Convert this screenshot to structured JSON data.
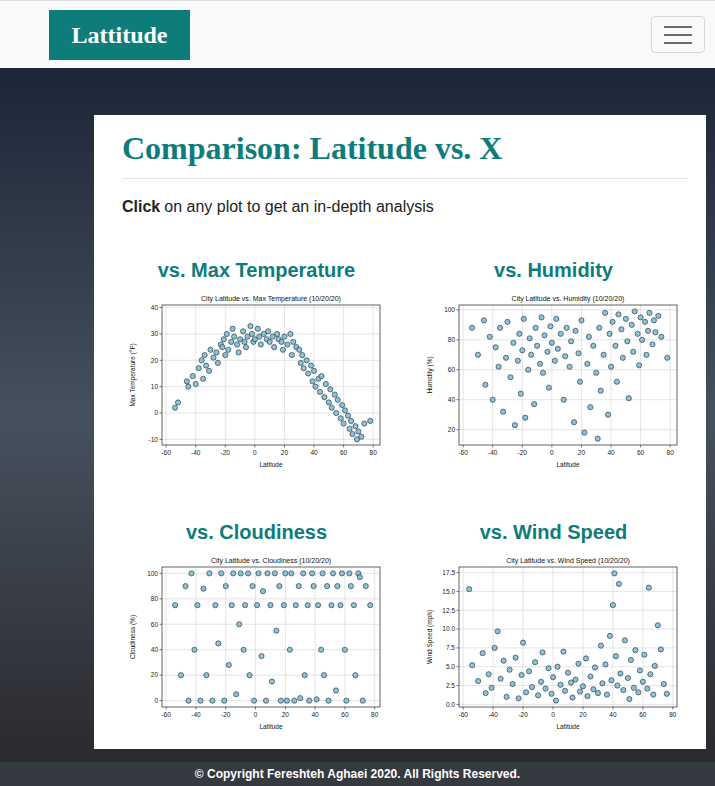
{
  "navbar": {
    "brand": "Lattitude"
  },
  "card": {
    "title": "Comparison: Latitude vs. X",
    "intro": {
      "emphasis": "Click",
      "text": "on any plot to get an in-depth analysis"
    }
  },
  "charts": [
    {
      "heading": "vs. Max Temperature",
      "title": "City Latitude vs. Max Temperature (10/20/20)",
      "x_label": "Latitude",
      "y_label": "Max Temperature (°F)",
      "x_ticks": [
        "-60",
        "-40",
        "-20",
        "0",
        "20",
        "40",
        "60",
        "80"
      ],
      "y_ticks": [
        "-10",
        "0",
        "10",
        "20",
        "30",
        "40"
      ],
      "points": [
        [
          -54,
          2
        ],
        [
          -52,
          4
        ],
        [
          -46,
          12
        ],
        [
          -45,
          10
        ],
        [
          -42,
          14
        ],
        [
          -40,
          11
        ],
        [
          -38,
          17
        ],
        [
          -36,
          20
        ],
        [
          -35,
          13
        ],
        [
          -34,
          22
        ],
        [
          -33,
          18
        ],
        [
          -31,
          16
        ],
        [
          -30,
          24
        ],
        [
          -28,
          21
        ],
        [
          -26,
          23
        ],
        [
          -25,
          19
        ],
        [
          -23,
          26
        ],
        [
          -22,
          25
        ],
        [
          -21,
          28
        ],
        [
          -20,
          22
        ],
        [
          -19,
          30
        ],
        [
          -18,
          24
        ],
        [
          -16,
          27
        ],
        [
          -15,
          32
        ],
        [
          -14,
          29
        ],
        [
          -12,
          26
        ],
        [
          -11,
          23
        ],
        [
          -10,
          28
        ],
        [
          -8,
          31
        ],
        [
          -7,
          27
        ],
        [
          -6,
          25
        ],
        [
          -5,
          29
        ],
        [
          -3,
          33
        ],
        [
          -2,
          30
        ],
        [
          -1,
          27
        ],
        [
          0,
          28
        ],
        [
          2,
          32
        ],
        [
          3,
          29
        ],
        [
          4,
          26
        ],
        [
          6,
          30
        ],
        [
          8,
          28
        ],
        [
          9,
          31
        ],
        [
          10,
          27
        ],
        [
          12,
          29
        ],
        [
          13,
          25
        ],
        [
          15,
          30
        ],
        [
          16,
          28
        ],
        [
          18,
          27
        ],
        [
          19,
          24
        ],
        [
          20,
          29
        ],
        [
          22,
          26
        ],
        [
          24,
          30
        ],
        [
          25,
          22
        ],
        [
          26,
          27
        ],
        [
          28,
          25
        ],
        [
          30,
          24
        ],
        [
          31,
          19
        ],
        [
          32,
          22
        ],
        [
          33,
          17
        ],
        [
          35,
          20
        ],
        [
          36,
          15
        ],
        [
          38,
          18
        ],
        [
          39,
          12
        ],
        [
          40,
          16
        ],
        [
          41,
          10
        ],
        [
          43,
          13
        ],
        [
          44,
          8
        ],
        [
          45,
          14
        ],
        [
          47,
          6
        ],
        [
          48,
          11
        ],
        [
          50,
          4
        ],
        [
          51,
          9
        ],
        [
          52,
          2
        ],
        [
          54,
          7
        ],
        [
          55,
          0
        ],
        [
          56,
          5
        ],
        [
          58,
          -2
        ],
        [
          59,
          3
        ],
        [
          60,
          -4
        ],
        [
          61,
          1
        ],
        [
          63,
          -1
        ],
        [
          64,
          -6
        ],
        [
          65,
          -3
        ],
        [
          66,
          -8
        ],
        [
          68,
          -5
        ],
        [
          69,
          -10
        ],
        [
          70,
          -7
        ],
        [
          72,
          -9
        ],
        [
          74,
          -4
        ],
        [
          78,
          -3
        ]
      ]
    },
    {
      "heading": "vs. Humidity",
      "title": "City Latitude vs. Humidity (10/20/20)",
      "x_label": "Latitude",
      "y_label": "Humidity (%)",
      "x_ticks": [
        "-60",
        "-40",
        "-20",
        "0",
        "20",
        "40",
        "60",
        "80"
      ],
      "y_ticks": [
        "20",
        "40",
        "60",
        "80",
        "100"
      ],
      "points": [
        [
          -54,
          88
        ],
        [
          -50,
          70
        ],
        [
          -46,
          93
        ],
        [
          -45,
          50
        ],
        [
          -42,
          82
        ],
        [
          -40,
          40
        ],
        [
          -38,
          75
        ],
        [
          -36,
          62
        ],
        [
          -35,
          88
        ],
        [
          -33,
          32
        ],
        [
          -31,
          68
        ],
        [
          -30,
          92
        ],
        [
          -28,
          55
        ],
        [
          -26,
          78
        ],
        [
          -25,
          23
        ],
        [
          -23,
          66
        ],
        [
          -22,
          84
        ],
        [
          -21,
          44
        ],
        [
          -20,
          73
        ],
        [
          -19,
          94
        ],
        [
          -18,
          28
        ],
        [
          -16,
          60
        ],
        [
          -15,
          81
        ],
        [
          -14,
          70
        ],
        [
          -12,
          37
        ],
        [
          -11,
          88
        ],
        [
          -10,
          76
        ],
        [
          -8,
          64
        ],
        [
          -7,
          95
        ],
        [
          -6,
          58
        ],
        [
          -5,
          83
        ],
        [
          -3,
          72
        ],
        [
          -2,
          48
        ],
        [
          -1,
          89
        ],
        [
          0,
          78
        ],
        [
          2,
          66
        ],
        [
          3,
          94
        ],
        [
          4,
          74
        ],
        [
          6,
          84
        ],
        [
          8,
          40
        ],
        [
          9,
          69
        ],
        [
          10,
          88
        ],
        [
          12,
          62
        ],
        [
          13,
          79
        ],
        [
          15,
          25
        ],
        [
          16,
          86
        ],
        [
          18,
          71
        ],
        [
          19,
          52
        ],
        [
          20,
          93
        ],
        [
          22,
          18
        ],
        [
          24,
          64
        ],
        [
          25,
          82
        ],
        [
          26,
          35
        ],
        [
          28,
          76
        ],
        [
          30,
          58
        ],
        [
          31,
          14
        ],
        [
          32,
          88
        ],
        [
          33,
          46
        ],
        [
          35,
          70
        ],
        [
          36,
          98
        ],
        [
          38,
          30
        ],
        [
          39,
          84
        ],
        [
          40,
          62
        ],
        [
          41,
          92
        ],
        [
          43,
          76
        ],
        [
          44,
          52
        ],
        [
          45,
          97
        ],
        [
          47,
          87
        ],
        [
          48,
          68
        ],
        [
          50,
          94
        ],
        [
          51,
          79
        ],
        [
          52,
          41
        ],
        [
          54,
          90
        ],
        [
          55,
          72
        ],
        [
          56,
          99
        ],
        [
          58,
          84
        ],
        [
          59,
          63
        ],
        [
          60,
          95
        ],
        [
          61,
          80
        ],
        [
          63,
          92
        ],
        [
          64,
          70
        ],
        [
          65,
          86
        ],
        [
          66,
          98
        ],
        [
          68,
          77
        ],
        [
          69,
          93
        ],
        [
          70,
          85
        ],
        [
          72,
          96
        ],
        [
          74,
          82
        ],
        [
          78,
          68
        ]
      ]
    },
    {
      "heading": "vs. Cloudiness",
      "title": "City Latitude vs. Cloudiness (10/20/20)",
      "x_label": "Latitude",
      "y_label": "Cloudiness (%)",
      "x_ticks": [
        "-60",
        "-40",
        "-20",
        "0",
        "20",
        "40",
        "60",
        "80"
      ],
      "y_ticks": [
        "0",
        "20",
        "40",
        "60",
        "80",
        "100"
      ],
      "points": [
        [
          -54,
          75
        ],
        [
          -50,
          20
        ],
        [
          -47,
          90
        ],
        [
          -45,
          0
        ],
        [
          -43,
          100
        ],
        [
          -41,
          40
        ],
        [
          -39,
          75
        ],
        [
          -37,
          0
        ],
        [
          -35,
          88
        ],
        [
          -33,
          20
        ],
        [
          -31,
          100
        ],
        [
          -29,
          0
        ],
        [
          -27,
          75
        ],
        [
          -25,
          45
        ],
        [
          -23,
          100
        ],
        [
          -21,
          0
        ],
        [
          -20,
          90
        ],
        [
          -18,
          28
        ],
        [
          -16,
          75
        ],
        [
          -15,
          100
        ],
        [
          -13,
          5
        ],
        [
          -11,
          60
        ],
        [
          -10,
          100
        ],
        [
          -8,
          40
        ],
        [
          -7,
          75
        ],
        [
          -5,
          100
        ],
        [
          -4,
          20
        ],
        [
          -2,
          90
        ],
        [
          -1,
          0
        ],
        [
          1,
          75
        ],
        [
          2,
          100
        ],
        [
          4,
          35
        ],
        [
          5,
          86
        ],
        [
          7,
          0
        ],
        [
          8,
          100
        ],
        [
          10,
          75
        ],
        [
          11,
          15
        ],
        [
          13,
          100
        ],
        [
          14,
          55
        ],
        [
          16,
          90
        ],
        [
          17,
          0
        ],
        [
          19,
          75
        ],
        [
          20,
          100
        ],
        [
          21,
          0
        ],
        [
          23,
          40
        ],
        [
          24,
          100
        ],
        [
          26,
          0
        ],
        [
          27,
          75
        ],
        [
          29,
          90
        ],
        [
          30,
          2
        ],
        [
          32,
          100
        ],
        [
          33,
          20
        ],
        [
          35,
          75
        ],
        [
          36,
          0
        ],
        [
          38,
          100
        ],
        [
          39,
          90
        ],
        [
          41,
          1
        ],
        [
          42,
          75
        ],
        [
          44,
          40
        ],
        [
          45,
          100
        ],
        [
          46,
          20
        ],
        [
          48,
          90
        ],
        [
          49,
          0
        ],
        [
          51,
          75
        ],
        [
          52,
          100
        ],
        [
          54,
          8
        ],
        [
          55,
          90
        ],
        [
          57,
          75
        ],
        [
          58,
          100
        ],
        [
          60,
          40
        ],
        [
          61,
          0
        ],
        [
          63,
          100
        ],
        [
          64,
          90
        ],
        [
          66,
          75
        ],
        [
          67,
          20
        ],
        [
          69,
          100
        ],
        [
          70,
          97
        ],
        [
          72,
          0
        ],
        [
          74,
          90
        ],
        [
          77,
          75
        ]
      ]
    },
    {
      "heading": "vs. Wind Speed",
      "title": "City Latitude vs. Wind Speed (10/20/20)",
      "x_label": "Latitude",
      "y_label": "Wind Speed (mph)",
      "x_ticks": [
        "-60",
        "-40",
        "-20",
        "0",
        "20",
        "40",
        "60",
        "80"
      ],
      "y_ticks": [
        "0.0",
        "2.5",
        "5.0",
        "7.5",
        "10.0",
        "12.5",
        "15.0",
        "17.5"
      ],
      "points": [
        [
          -56,
          15.3
        ],
        [
          -54,
          5.2
        ],
        [
          -50,
          3.1
        ],
        [
          -47,
          6.8
        ],
        [
          -45,
          1.5
        ],
        [
          -43,
          4.0
        ],
        [
          -41,
          2.2
        ],
        [
          -39,
          7.5
        ],
        [
          -37,
          9.7
        ],
        [
          -35,
          3.4
        ],
        [
          -33,
          5.8
        ],
        [
          -31,
          1.0
        ],
        [
          -29,
          4.6
        ],
        [
          -27,
          2.7
        ],
        [
          -25,
          6.2
        ],
        [
          -23,
          0.8
        ],
        [
          -21,
          3.9
        ],
        [
          -20,
          8.2
        ],
        [
          -18,
          1.6
        ],
        [
          -16,
          4.4
        ],
        [
          -14,
          2.3
        ],
        [
          -12,
          5.6
        ],
        [
          -10,
          1.2
        ],
        [
          -8,
          3.0
        ],
        [
          -7,
          6.9
        ],
        [
          -5,
          2.1
        ],
        [
          -3,
          4.8
        ],
        [
          -1,
          1.4
        ],
        [
          0,
          3.6
        ],
        [
          2,
          0.5
        ],
        [
          3,
          5.0
        ],
        [
          5,
          2.6
        ],
        [
          7,
          7.0
        ],
        [
          8,
          1.8
        ],
        [
          10,
          4.2
        ],
        [
          12,
          2.9
        ],
        [
          13,
          0.9
        ],
        [
          15,
          3.3
        ],
        [
          17,
          5.4
        ],
        [
          18,
          1.7
        ],
        [
          20,
          2.4
        ],
        [
          22,
          6.1
        ],
        [
          23,
          1.1
        ],
        [
          25,
          3.7
        ],
        [
          27,
          2.0
        ],
        [
          28,
          4.9
        ],
        [
          30,
          1.5
        ],
        [
          32,
          7.8
        ],
        [
          33,
          2.8
        ],
        [
          35,
          5.3
        ],
        [
          36,
          1.3
        ],
        [
          38,
          9.1
        ],
        [
          39,
          3.2
        ],
        [
          40,
          13.2
        ],
        [
          41,
          17.4
        ],
        [
          42,
          6.4
        ],
        [
          43,
          2.5
        ],
        [
          44,
          16.0
        ],
        [
          45,
          4.1
        ],
        [
          47,
          1.9
        ],
        [
          48,
          8.5
        ],
        [
          50,
          3.5
        ],
        [
          51,
          0.7
        ],
        [
          52,
          5.9
        ],
        [
          54,
          2.2
        ],
        [
          55,
          7.2
        ],
        [
          57,
          1.6
        ],
        [
          58,
          4.5
        ],
        [
          60,
          3.0
        ],
        [
          61,
          6.6
        ],
        [
          63,
          2.1
        ],
        [
          64,
          15.5
        ],
        [
          65,
          4.0
        ],
        [
          67,
          1.3
        ],
        [
          68,
          5.1
        ],
        [
          70,
          10.5
        ],
        [
          72,
          7.3
        ],
        [
          74,
          2.7
        ],
        [
          76,
          1.4
        ]
      ]
    }
  ],
  "footer": "© Copyright Fereshteh Aghaei 2020. All Rights Reserved."
}
